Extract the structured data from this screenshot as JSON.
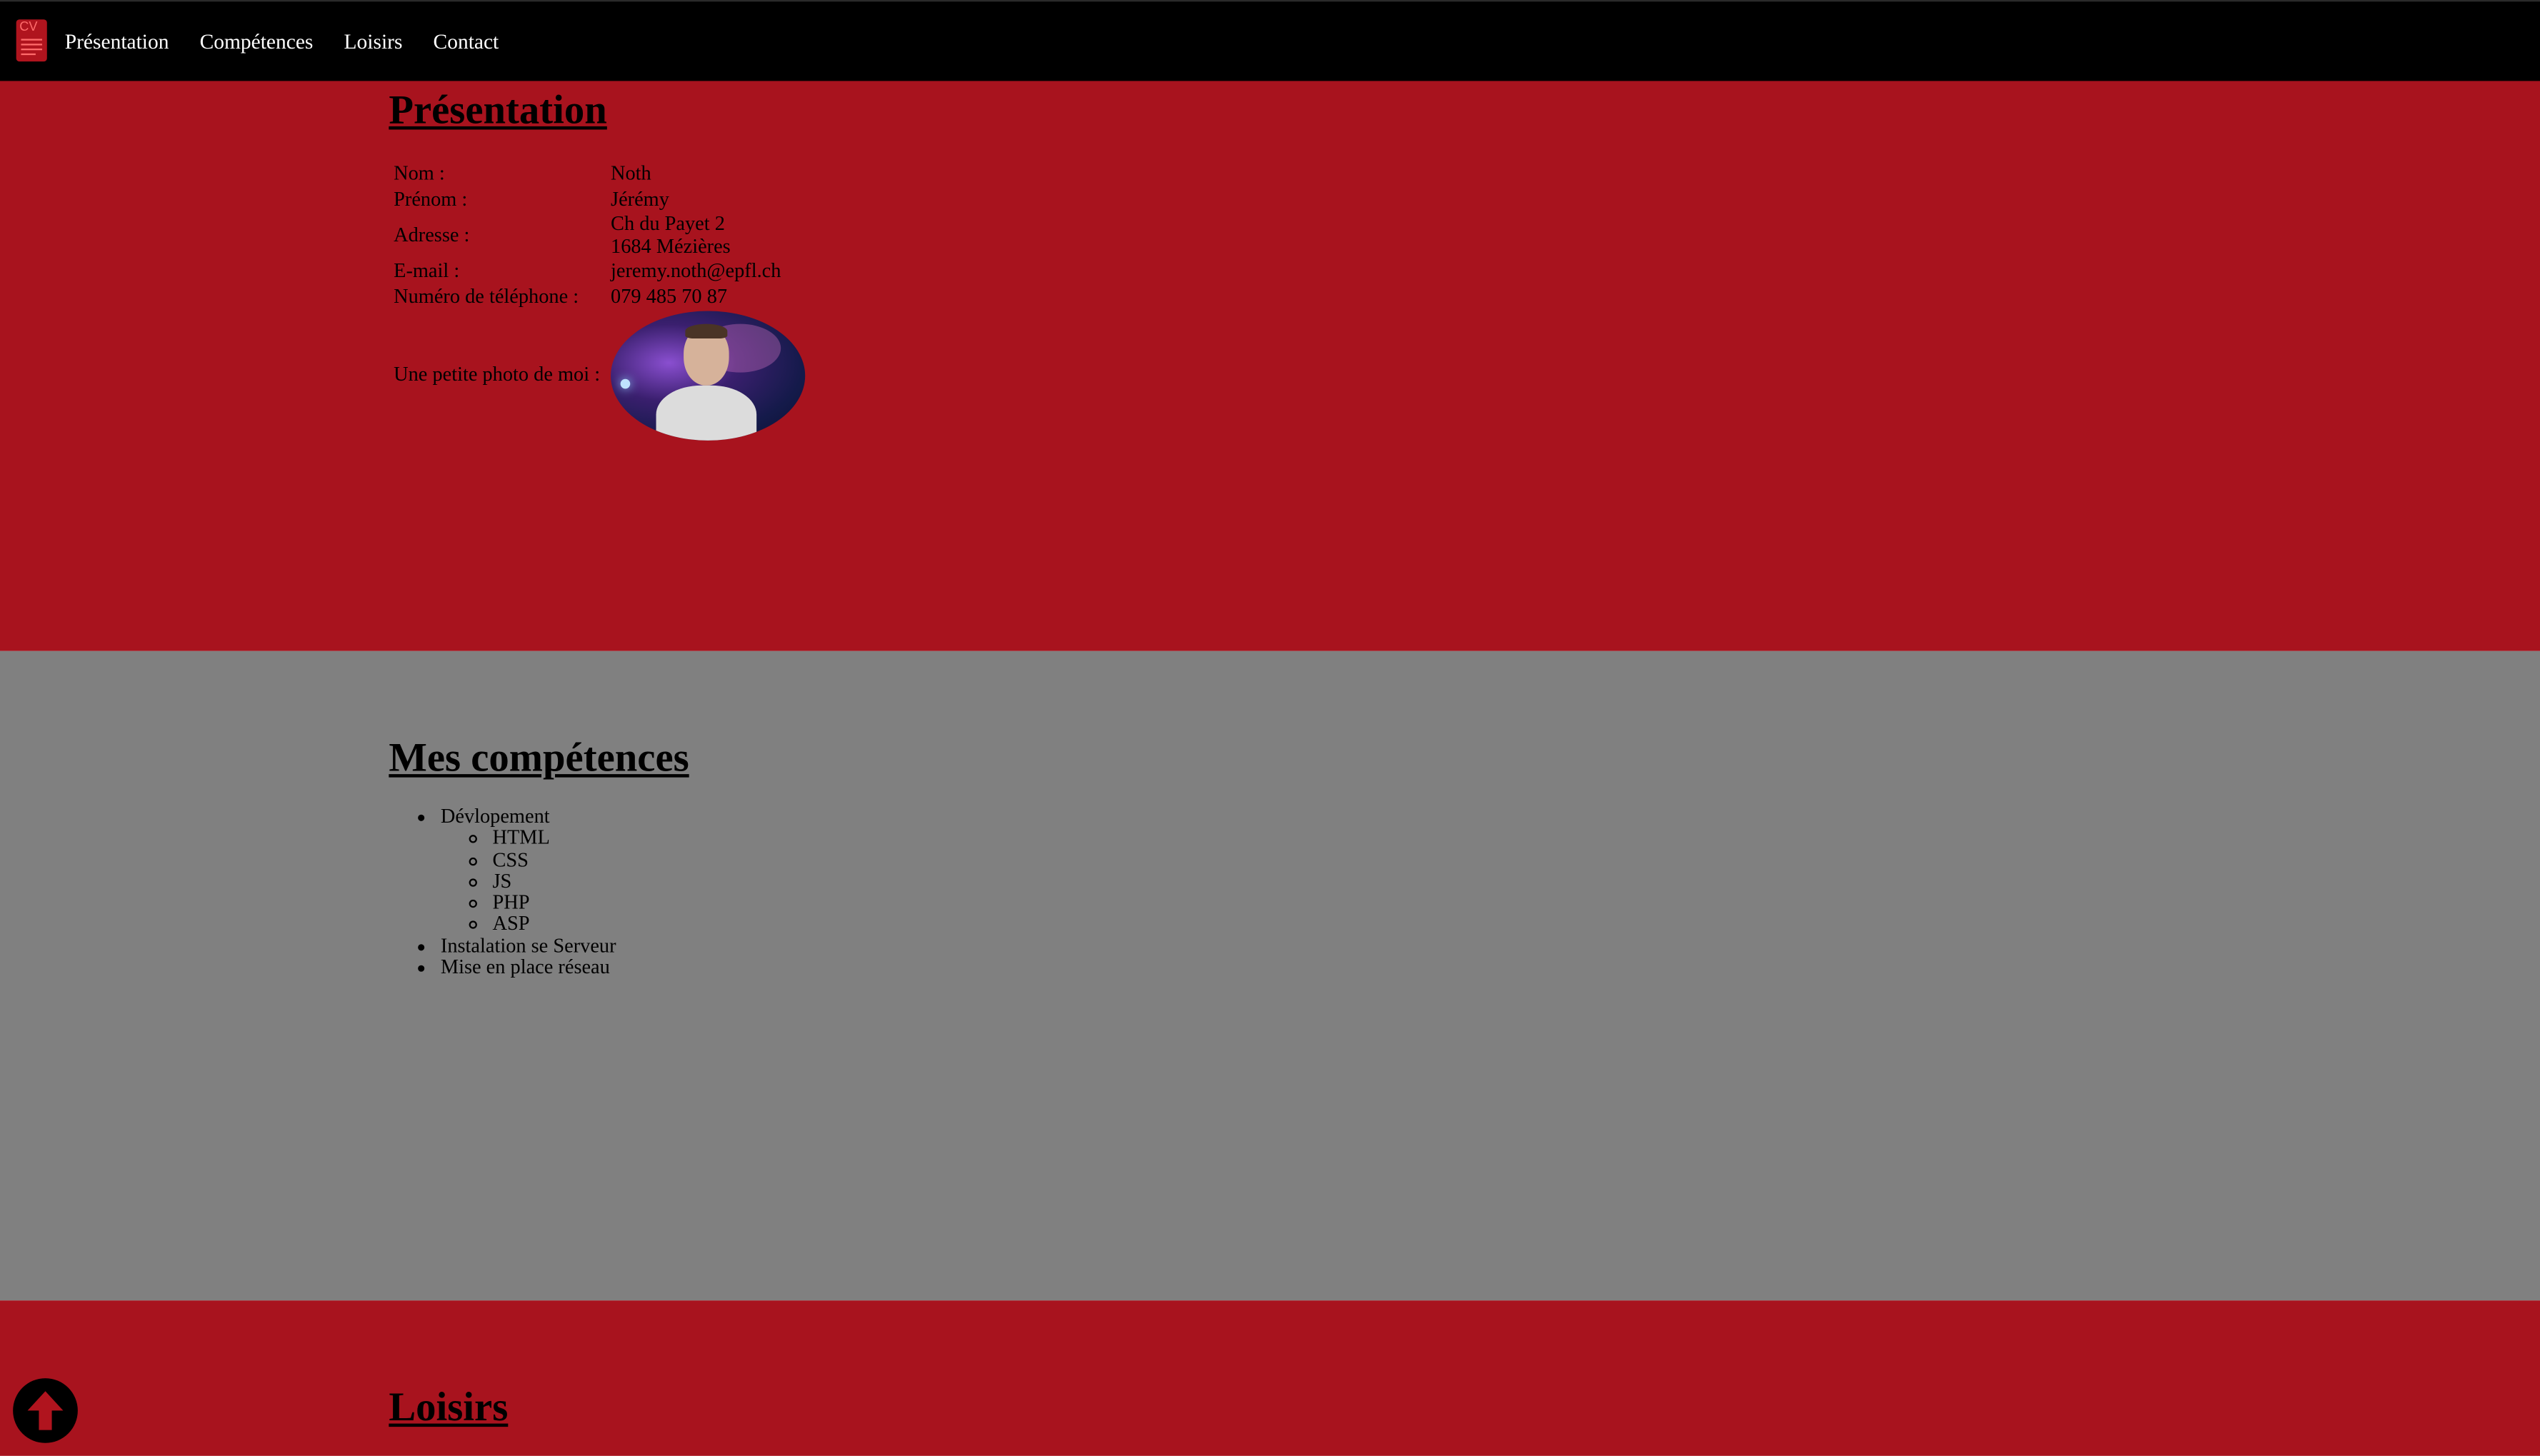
{
  "nav": {
    "logo_text": "CV",
    "links": [
      "Présentation",
      "Compétences",
      "Loisirs",
      "Contact"
    ]
  },
  "presentation": {
    "title": "Présentation",
    "rows": [
      {
        "label": "Nom :",
        "value": "Noth"
      },
      {
        "label": "Prénom :",
        "value": "Jérémy"
      },
      {
        "label": "Adresse :",
        "value_line1": "Ch du Payet 2",
        "value_line2": "1684 Mézières"
      },
      {
        "label": "E-mail :",
        "value": "jeremy.noth@epfl.ch"
      },
      {
        "label": "Numéro de téléphone :",
        "value": "079 485 70 87"
      },
      {
        "label": "Une petite photo de moi :"
      }
    ]
  },
  "competences": {
    "title": "Mes compétences",
    "items": [
      {
        "label": "Dévlopement",
        "children": [
          "HTML",
          "CSS",
          "JS",
          "PHP",
          "ASP"
        ]
      },
      {
        "label": "Instalation se Serveur"
      },
      {
        "label": "Mise en place réseau"
      }
    ]
  },
  "loisirs": {
    "title": "Loisirs"
  },
  "back_to_top": {
    "icon": "arrow-up-icon"
  },
  "colors": {
    "nav_bg": "#000000",
    "red_section": "#a8131e",
    "gray_section": "#808080"
  }
}
